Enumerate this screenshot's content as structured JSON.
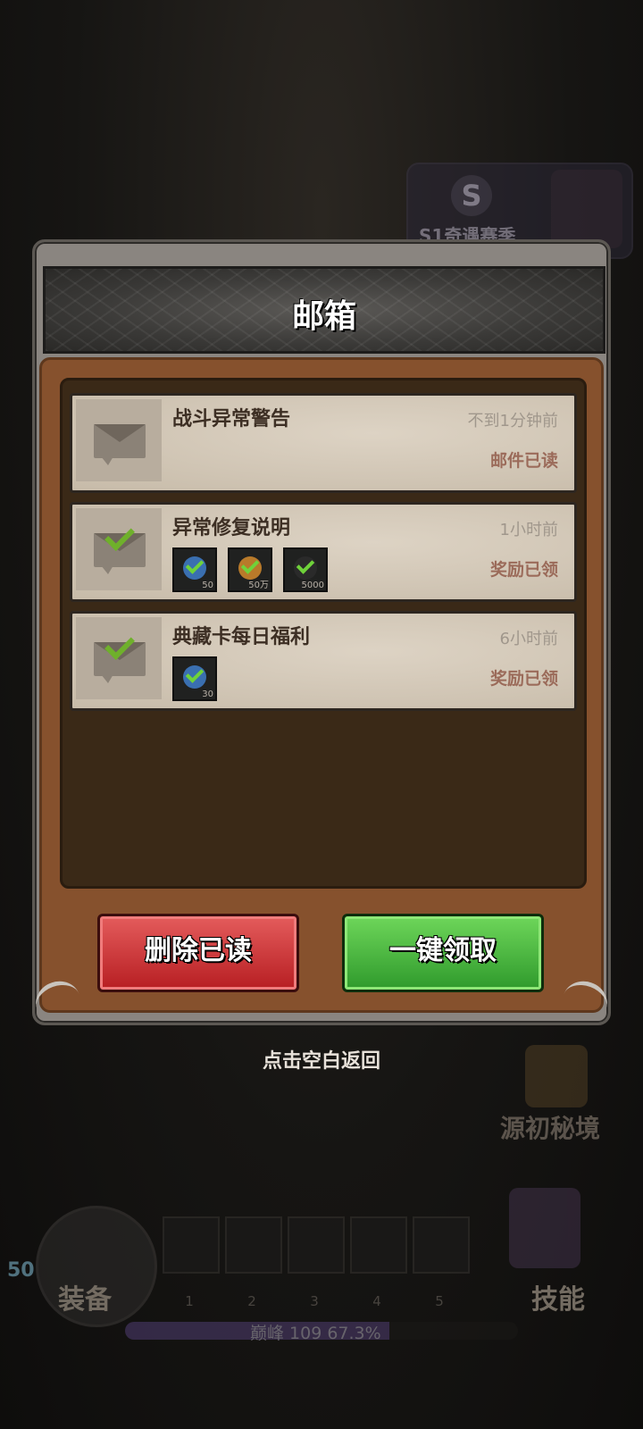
{
  "background": {
    "season_label": "S1奇遇赛季",
    "season_icon": "S",
    "dungeon_label": "源初秘境",
    "equip_label": "装备",
    "skill_label": "技能",
    "level_badge": "50",
    "slot_numbers": [
      "1",
      "2",
      "3",
      "4",
      "5"
    ],
    "xp_text": "巅峰 109  67.3%",
    "xp_progress": 0.673
  },
  "dialog": {
    "title": "邮箱",
    "mails": [
      {
        "subject": "战斗异常警告",
        "time": "不到1分钟前",
        "status": "邮件已读",
        "claimed": false,
        "rewards": []
      },
      {
        "subject": "异常修复说明",
        "time": "1小时前",
        "status": "奖励已领",
        "claimed": true,
        "rewards": [
          {
            "icon": "blue-gem-icon",
            "qty": "50",
            "color": "#3a6fb0"
          },
          {
            "icon": "gold-coin-icon",
            "qty": "50万",
            "color": "#b87a2a"
          },
          {
            "icon": "green-material-icon",
            "qty": "5000",
            "color": "#2a2a2a"
          }
        ]
      },
      {
        "subject": "典藏卡每日福利",
        "time": "6小时前",
        "status": "奖励已领",
        "claimed": true,
        "rewards": [
          {
            "icon": "blue-gem-icon",
            "qty": "30",
            "color": "#3a6fb0"
          }
        ]
      }
    ],
    "delete_read_label": "删除已读",
    "claim_all_label": "一键领取"
  },
  "back_hint": "点击空白返回",
  "colors": {
    "delete_button": "#c9343a",
    "claim_button": "#4dba3d",
    "read_status": "#9b6b5a"
  }
}
